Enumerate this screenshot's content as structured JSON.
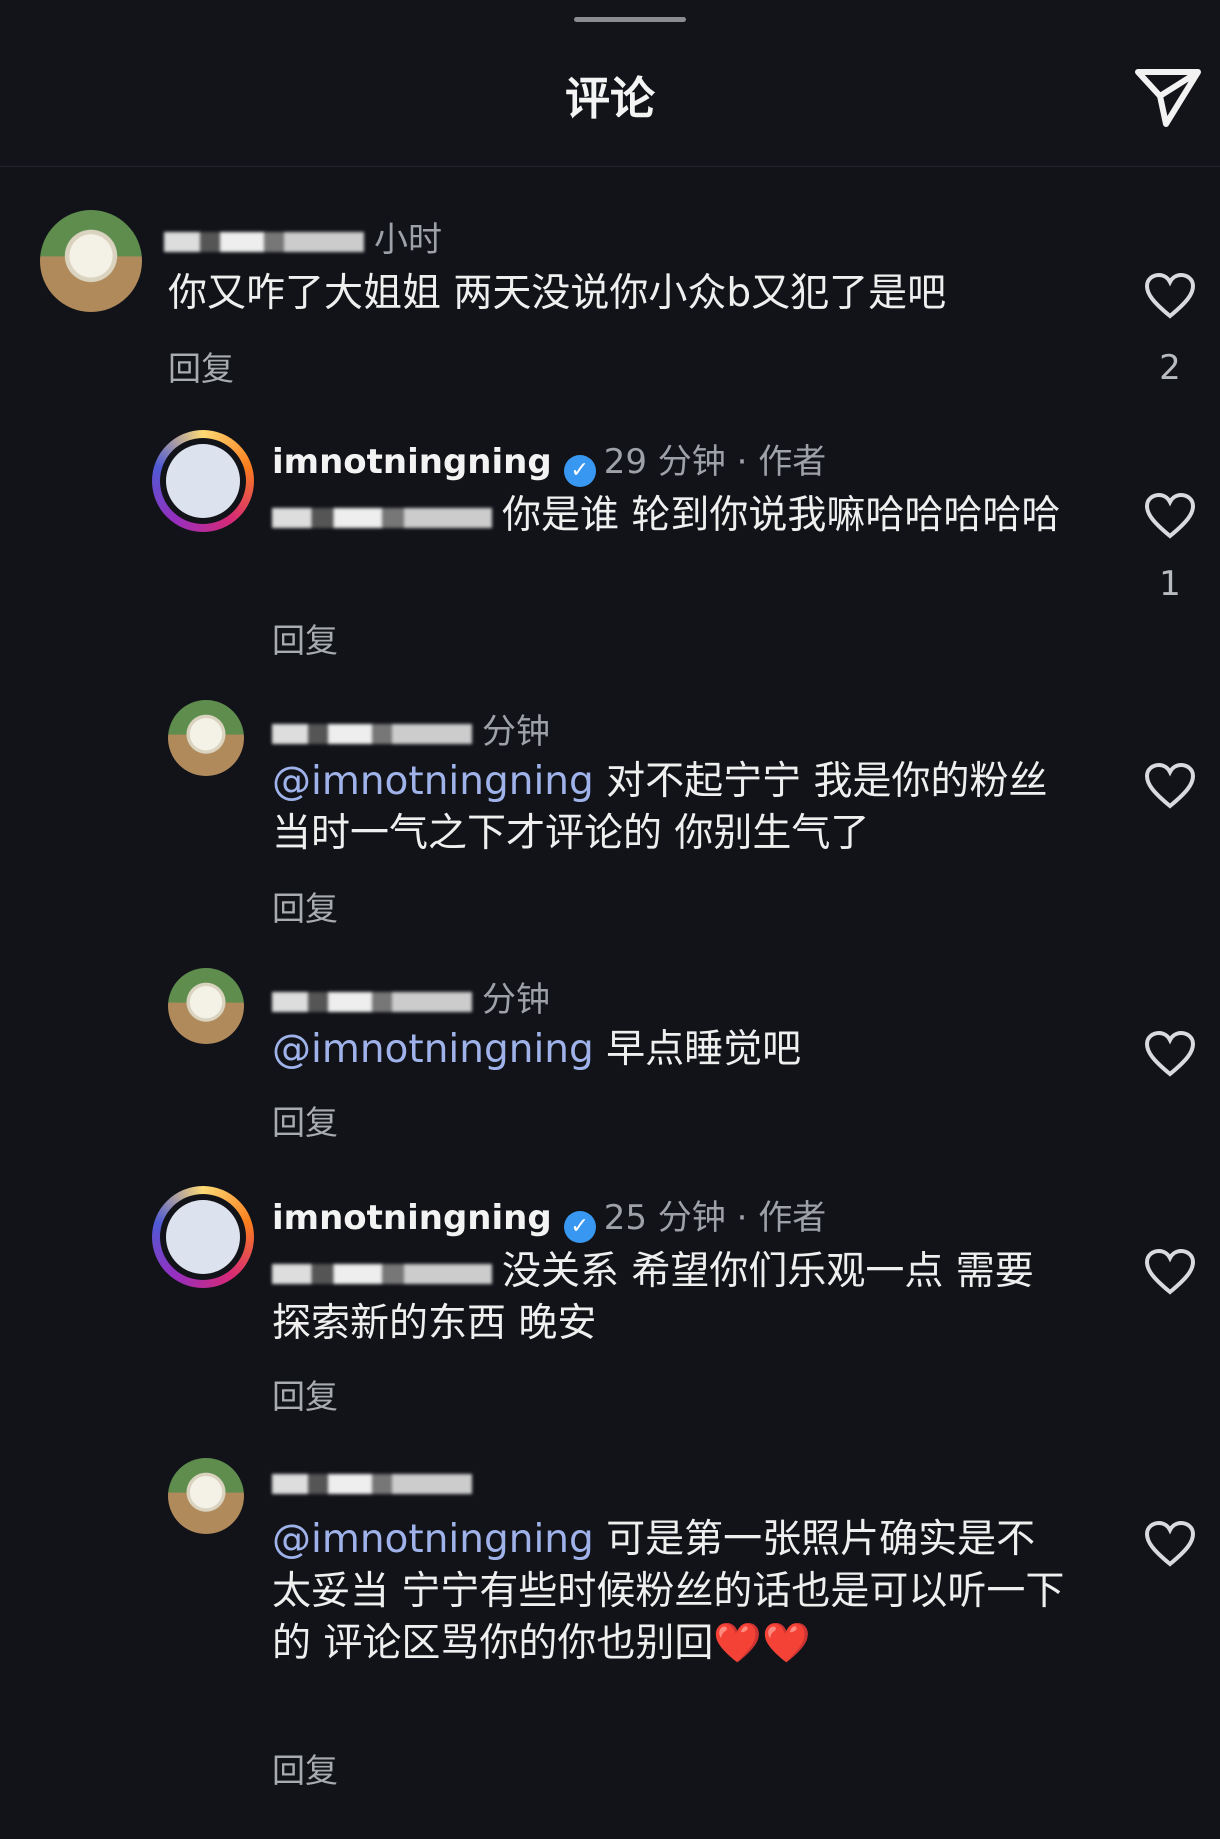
{
  "header": {
    "title": "评论",
    "share_icon": "send-icon"
  },
  "comments": [
    {
      "time": "小时",
      "text": "你又咋了大姐姐 两天没说你小众b又犯了是吧",
      "reply": "回复",
      "likes": "2"
    },
    {
      "username": "imnotningning",
      "time": "29 分钟 · 作者",
      "text": "你是谁 轮到你说我嘛哈哈哈哈哈",
      "reply": "回复",
      "likes": "1"
    },
    {
      "time": "分钟",
      "mention": "@imnotningning",
      "text": " 对不起宁宁 我是你的粉丝 当时一气之下才评论的 你别生气了",
      "reply": "回复"
    },
    {
      "time": "分钟",
      "mention": "@imnotningning",
      "text": " 早点睡觉吧",
      "reply": "回复"
    },
    {
      "username": "imnotningning",
      "time": "25 分钟 · 作者",
      "text": "没关系 希望你们乐观一点 需要探索新的东西 晚安",
      "reply": "回复"
    },
    {
      "mention": "@imnotningning",
      "text": " 可是第一张照片确实是不太妥当 宁宁有些时候粉丝的话也是可以听一下的 评论区骂你的你也别回❤️❤️",
      "reply": "回复"
    }
  ],
  "colors": {
    "background": "#111318",
    "mention": "#9fb3ea",
    "verified": "#3897f0"
  }
}
